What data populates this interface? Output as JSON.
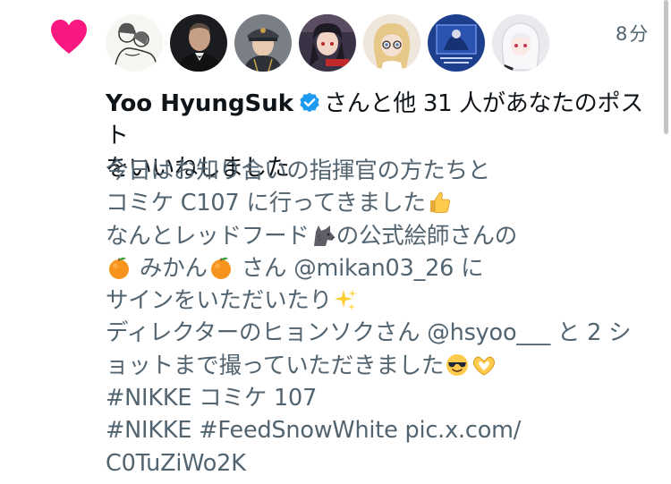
{
  "notification": {
    "type_icon": "heart-icon",
    "time": "8分",
    "avatars": [
      {
        "name": "avatar-sketch-couple"
      },
      {
        "name": "avatar-man-tuxedo"
      },
      {
        "name": "avatar-uniform-cap"
      },
      {
        "name": "avatar-anime-girl-dark"
      },
      {
        "name": "avatar-anime-girl-blonde"
      },
      {
        "name": "avatar-event-poster"
      },
      {
        "name": "avatar-anime-girl-white"
      }
    ],
    "headline": {
      "user_name": "Yoo HyungSuk",
      "verified_icon": "verified-badge-icon",
      "text_line1": "さんと他 31 人があなたのポスト",
      "text_line2": "をいいねしました"
    },
    "post_lines": [
      {
        "text": "今日はお知り合いの指揮官の方たちと"
      },
      {
        "text": "コミケ C107 に行ってきました",
        "emoji_after": "thumbs-up-icon"
      },
      {
        "text_before": "なんとレッドフード",
        "emoji_mid": "wolf-icon",
        "text_after": "の公式絵師さんの"
      },
      {
        "emoji_before": "orange-icon",
        "text_before": " みかん",
        "emoji_mid": "orange-icon",
        "text_after": " さん @mikan03_26 に"
      },
      {
        "text": "サインをいただいたり",
        "emoji_after": "sparkles-icon"
      },
      {
        "text": "ディレクターのヒョンソクさん @hsyoo___ と 2 シ"
      },
      {
        "text": "ョットまで撮っていただきました",
        "emoji_after": "sunglasses-face-icon",
        "emoji_after2": "heart-hands-icon"
      },
      {
        "text": "#NIKKE コミケ 107"
      },
      {
        "text": "#NIKKE #FeedSnowWhite pic.x.com/"
      },
      {
        "text": "C0TuZiWo2K"
      }
    ]
  }
}
